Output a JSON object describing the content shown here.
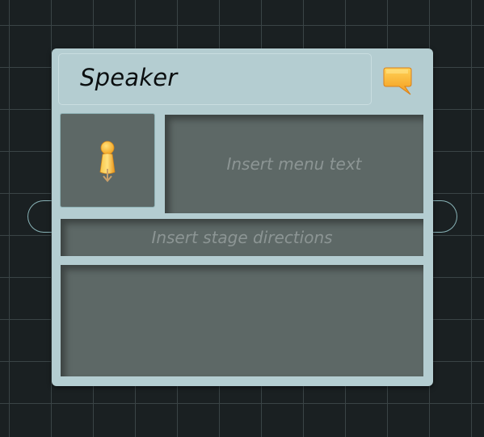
{
  "node": {
    "title": "Speaker",
    "menu_text_placeholder": "Insert menu text",
    "stage_directions_placeholder": "Insert stage directions",
    "dialogue_text": "",
    "icons": {
      "menu": "speech-bubble-icon",
      "portrait": "pin-icon"
    },
    "colors": {
      "canvas_background": "#1a2022",
      "grid_line": "#3a4446",
      "node_background": "#b4cdd1",
      "field_background": "#5d6866",
      "placeholder_text": "#8c9594",
      "accent_orange": "#f5a623"
    }
  }
}
